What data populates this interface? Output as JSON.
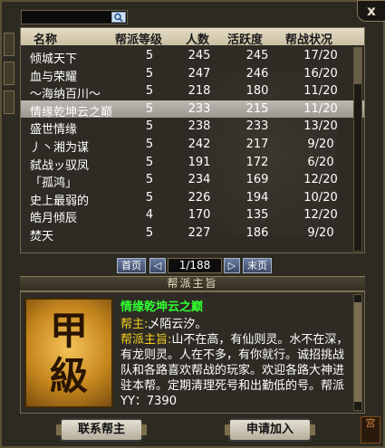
{
  "window": {
    "close_label": "x"
  },
  "search": {
    "value": "",
    "icon": "search-icon"
  },
  "list": {
    "columns": {
      "name": "名称",
      "level": "帮派等级",
      "members": "人数",
      "activity": "活跃度",
      "war": "帮战状况"
    },
    "rows": [
      {
        "name": "倾城天下",
        "level": "5",
        "members": "245",
        "activity": "245",
        "war": "17/20"
      },
      {
        "name": "血与荣耀",
        "level": "5",
        "members": "247",
        "activity": "246",
        "war": "16/20"
      },
      {
        "name": "～海纳百川～",
        "level": "5",
        "members": "218",
        "activity": "180",
        "war": "11/20"
      },
      {
        "name": "情缘乾坤云之巅",
        "level": "5",
        "members": "233",
        "activity": "215",
        "war": "11/20",
        "selected": true
      },
      {
        "name": "盛世情缘",
        "level": "5",
        "members": "238",
        "activity": "233",
        "war": "13/20"
      },
      {
        "name": "丿丶湘为谋",
        "level": "5",
        "members": "242",
        "activity": "217",
        "war": "9/20"
      },
      {
        "name": "弑战ッ驭凤",
        "level": "5",
        "members": "191",
        "activity": "172",
        "war": "6/20"
      },
      {
        "name": "「孤鸿」",
        "level": "5",
        "members": "234",
        "activity": "169",
        "war": "12/20"
      },
      {
        "name": "史上最弱的",
        "level": "5",
        "members": "226",
        "activity": "194",
        "war": "10/20"
      },
      {
        "name": "皓月倾辰",
        "level": "4",
        "members": "170",
        "activity": "135",
        "war": "12/20"
      },
      {
        "name": "焚天",
        "level": "5",
        "members": "227",
        "activity": "186",
        "war": "9/20"
      }
    ]
  },
  "pager": {
    "first": "首页",
    "prev": "◁",
    "page": "1/188",
    "next": "▷",
    "last": "末页"
  },
  "detail": {
    "section_title": "帮派主旨",
    "badge_line1": "甲",
    "badge_line2": "級",
    "guild_name": "情缘乾坤云之巅",
    "leader_label": "帮主:",
    "leader_value": "乄陌云汐。",
    "motto_label": "帮派主旨:",
    "motto_value": "山不在高，有仙则灵。水不在深，有龙则灵。人在不多，有你就行。诚招挑战队和各路喜欢帮战的玩家。欢迎各路大神进驻本帮。定期清理死号和出勤低的号。帮派YY：7390"
  },
  "actions": {
    "contact": "联系帮主",
    "apply": "申请加入"
  },
  "corner_badge": "宫"
}
